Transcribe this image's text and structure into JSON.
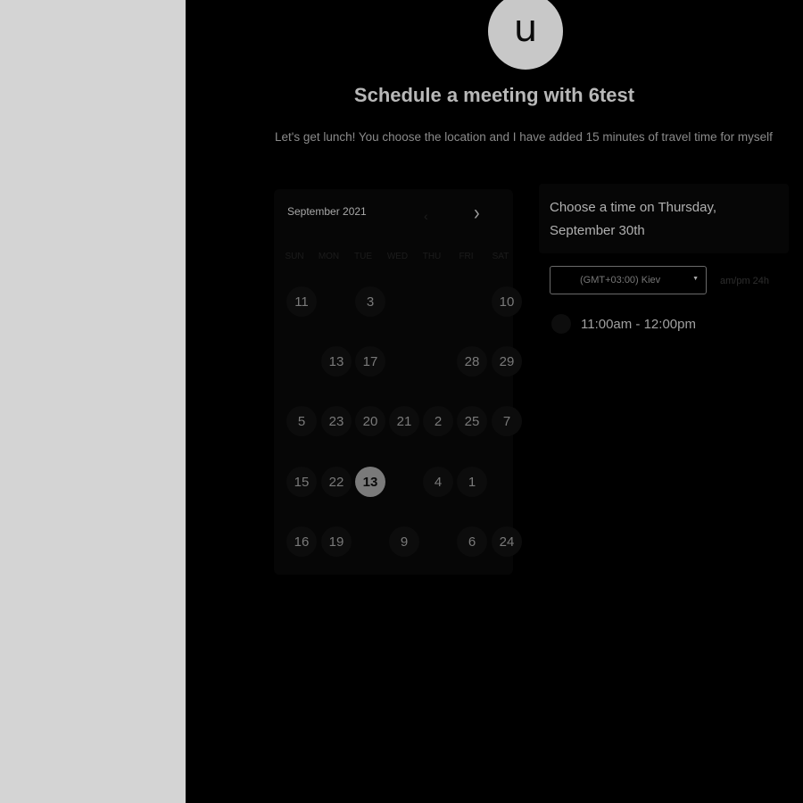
{
  "profile": {
    "avatar_letter": "u"
  },
  "title": "Schedule a meeting with 6test",
  "description": "Let's get lunch! You choose the location and I have added 15 minutes of travel time for myself",
  "calendar": {
    "month_label": "September 2021",
    "weekdays": [
      "SUN",
      "MON",
      "TUE",
      "WED",
      "THU",
      "FRI",
      "SAT"
    ],
    "rows": [
      [
        "11",
        "",
        "3",
        "",
        "",
        "",
        "10"
      ],
      [
        "",
        "13",
        "17",
        "",
        "",
        "28",
        "29"
      ],
      [
        "5",
        "23",
        "20",
        "21",
        "2",
        "25",
        "7"
      ],
      [
        "15",
        "22",
        "13",
        "",
        "4",
        "1",
        ""
      ],
      [
        "16",
        "19",
        "",
        "9",
        "",
        "6",
        "24"
      ]
    ],
    "selected_day": "13"
  },
  "time_panel": {
    "heading": "Choose a time on Thursday, September 30th",
    "timezone": "(GMT+03:00) Kiev",
    "format_toggle": "am/pm  24h",
    "slots": [
      "11:00am - 12:00pm"
    ]
  }
}
